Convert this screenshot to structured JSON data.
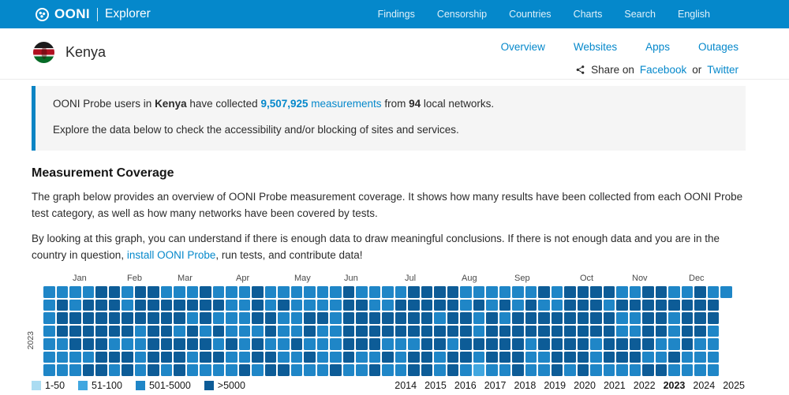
{
  "navbar": {
    "brand": {
      "name": "OONI",
      "product": "Explorer"
    },
    "links": [
      {
        "label": "Findings"
      },
      {
        "label": "Censorship"
      },
      {
        "label": "Countries"
      },
      {
        "label": "Charts"
      },
      {
        "label": "Search"
      },
      {
        "label": "English"
      }
    ]
  },
  "header": {
    "country": "Kenya",
    "tabs": [
      {
        "label": "Overview"
      },
      {
        "label": "Websites"
      },
      {
        "label": "Apps"
      },
      {
        "label": "Outages"
      }
    ],
    "share": {
      "prefix": "Share on",
      "facebook": "Facebook",
      "or": "or",
      "twitter": "Twitter"
    }
  },
  "summary": {
    "pre": "OONI Probe users in",
    "country": "Kenya",
    "mid": "have collected",
    "count": "9,507,925",
    "count_label": "measurements",
    "from": "from",
    "networks": "94",
    "post": "local networks.",
    "line2": "Explore the data below to check the accessibility and/or blocking of sites and services."
  },
  "coverage": {
    "title": "Measurement Coverage",
    "p1": "The graph below provides an overview of OONI Probe measurement coverage. It shows how many results have been collected from each OONI Probe test category, as well as how many networks have been covered by tests.",
    "p2_pre": "By looking at this graph, you can understand if there is enough data to draw meaningful conclusions. If there is not enough data and you are in the country in question,",
    "p2_link": "install OONI Probe",
    "p2_post": ", run tests, and contribute data!"
  },
  "chart_data": {
    "type": "heatmap",
    "title": "OONI Probe measurement coverage per week, Kenya 2023",
    "year_label": "2023",
    "months": [
      "Jan",
      "Feb",
      "Mar",
      "Apr",
      "May",
      "Jun",
      "Jul",
      "Aug",
      "Sep",
      "Oct",
      "Nov",
      "Dec"
    ],
    "rows": 7,
    "cols": 53,
    "level_colors": {
      "1": "#abdcf2",
      "2": "#41a7e0",
      "3": "#1f86c7",
      "4": "#0d5c97"
    },
    "level_labels": {
      "1": "1-50",
      "2": "51-100",
      "3": "501-5000",
      "4": ">5000"
    },
    "grid": [
      "33334434433343334333333433334444333333434444334433433",
      "34344434444444334343333443344444343434334443444444440",
      "34444444444343334433443444444434434344444444334434440",
      "34444443443434333433433444444444434444444444334434430",
      "33444333444443434334333444333443444443444434444334330",
      "33334443444344334433433433434434434443344434443343330",
      "33344343434333343443334334334434323343343433334433330"
    ],
    "legend": [
      {
        "level": "1",
        "label": "1-50"
      },
      {
        "level": "2",
        "label": "51-100"
      },
      {
        "level": "3",
        "label": "501-5000"
      },
      {
        "level": "4",
        "label": ">5000"
      }
    ],
    "years": [
      "2014",
      "2015",
      "2016",
      "2017",
      "2018",
      "2019",
      "2020",
      "2021",
      "2022",
      "2023",
      "2024",
      "2025"
    ],
    "selected_year": "2023"
  },
  "colors": {
    "brand_blue": "#0588cb",
    "box_border_blue": "#0b84c4"
  }
}
